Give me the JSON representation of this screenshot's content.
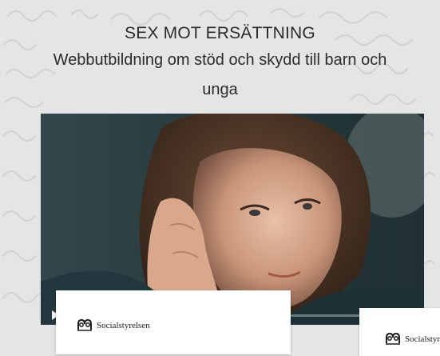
{
  "heading": {
    "title": "SEX MOT ERSÄTTNING",
    "subtitle_line1": "Webbutbildning om stöd och skydd till barn och",
    "subtitle_line2": "unga"
  },
  "video": {
    "state": "paused"
  },
  "cards": [
    {
      "logo_text": "Socialstyrelsen"
    },
    {
      "logo_text": "Socialstyre"
    }
  ],
  "colors": {
    "background": "#e4e6e5",
    "text": "#2b2b2b",
    "card": "#ffffff"
  }
}
